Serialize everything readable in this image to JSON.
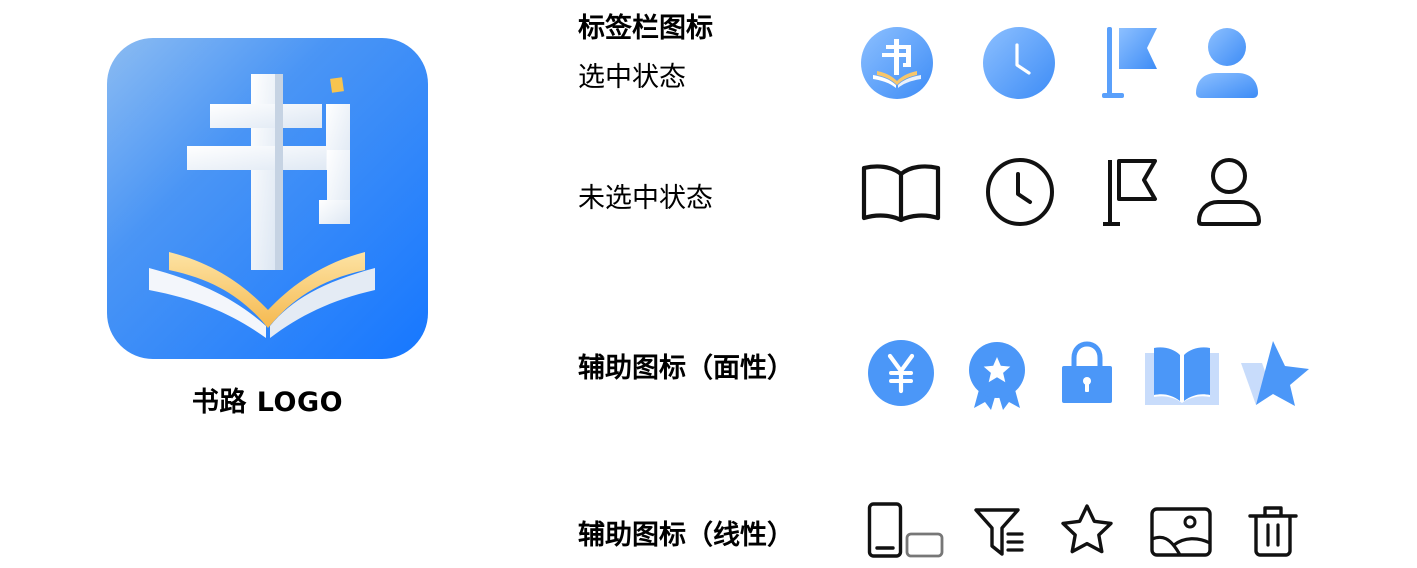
{
  "logo": {
    "caption": "书路 LOGO",
    "colors": {
      "bg_start": "#8cbcf2",
      "bg_end": "#1677ff",
      "glyph": "#f1f5fa",
      "book_gold": "#f9c66a",
      "accent": "#f7c44f"
    }
  },
  "sections": {
    "tabbar_title": "标签栏图标",
    "selected_label": "选中状态",
    "unselected_label": "未选中状态",
    "aux_filled_title": "辅助图标（面性）",
    "aux_line_title": "辅助图标（线性）"
  },
  "icons": {
    "tab_selected": [
      "book-logo-icon",
      "clock-icon",
      "flag-icon",
      "user-icon"
    ],
    "tab_unselected": [
      "book-open-icon",
      "clock-icon",
      "flag-icon",
      "user-icon"
    ],
    "aux_filled": [
      "yen-coin-icon",
      "award-badge-icon",
      "lock-icon",
      "book-open-icon",
      "star-icon"
    ],
    "aux_line": [
      "device-switch-icon",
      "filter-list-icon",
      "star-icon",
      "image-icon",
      "trash-icon"
    ]
  },
  "colors": {
    "blue": "#4b97f8",
    "blue_light": "#8dc0ff",
    "blue_pale": "#c8dcfb",
    "line": "#111111"
  }
}
